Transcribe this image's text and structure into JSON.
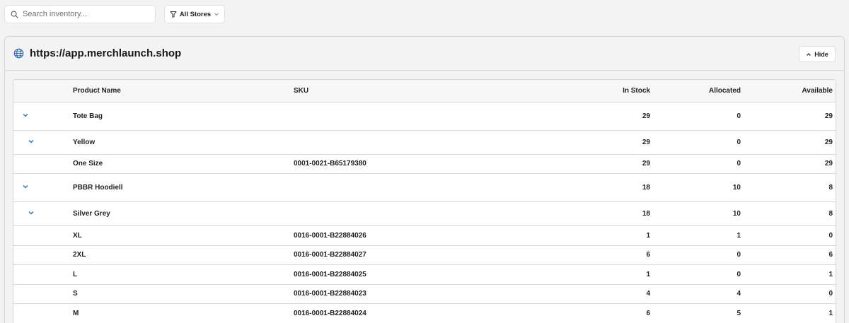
{
  "search": {
    "placeholder": "Search inventory..."
  },
  "store_filter": {
    "label": "All Stores"
  },
  "panel": {
    "title": "https://app.merchlaunch.shop",
    "hide_label": "Hide"
  },
  "table": {
    "columns": [
      "Product Name",
      "SKU",
      "In Stock",
      "Allocated",
      "Available"
    ],
    "rows": [
      {
        "level": 0,
        "expandable": true,
        "name": "Tote Bag",
        "sku": "",
        "in_stock": "29",
        "allocated": "0",
        "available": "29"
      },
      {
        "level": 1,
        "expandable": true,
        "name": "Yellow",
        "sku": "",
        "in_stock": "29",
        "allocated": "0",
        "available": "29"
      },
      {
        "level": 2,
        "expandable": false,
        "name": "One Size",
        "sku": "0001-0021-B65179380",
        "in_stock": "29",
        "allocated": "0",
        "available": "29"
      },
      {
        "level": 0,
        "expandable": true,
        "name": "PBBR Hoodiell",
        "sku": "",
        "in_stock": "18",
        "allocated": "10",
        "available": "8"
      },
      {
        "level": 1,
        "expandable": true,
        "name": "Silver Grey",
        "sku": "",
        "in_stock": "18",
        "allocated": "10",
        "available": "8"
      },
      {
        "level": 2,
        "expandable": false,
        "name": "XL",
        "sku": "0016-0001-B22884026",
        "in_stock": "1",
        "allocated": "1",
        "available": "0"
      },
      {
        "level": 2,
        "expandable": false,
        "name": "2XL",
        "sku": "0016-0001-B22884027",
        "in_stock": "6",
        "allocated": "0",
        "available": "6"
      },
      {
        "level": 2,
        "expandable": false,
        "name": "L",
        "sku": "0016-0001-B22884025",
        "in_stock": "1",
        "allocated": "0",
        "available": "1"
      },
      {
        "level": 2,
        "expandable": false,
        "name": "S",
        "sku": "0016-0001-B22884023",
        "in_stock": "4",
        "allocated": "4",
        "available": "0"
      },
      {
        "level": 2,
        "expandable": false,
        "name": "M",
        "sku": "0016-0001-B22884024",
        "in_stock": "6",
        "allocated": "5",
        "available": "1"
      }
    ]
  },
  "colors": {
    "accent": "#2f6fb0",
    "border": "#d6d6d6",
    "background": "#f3f3f3"
  },
  "icons": {
    "search": "search-icon",
    "filter": "filter-icon",
    "globe": "globe-icon",
    "collapse": "chevron-up-icon",
    "row_toggle": "chevron-down-icon"
  }
}
